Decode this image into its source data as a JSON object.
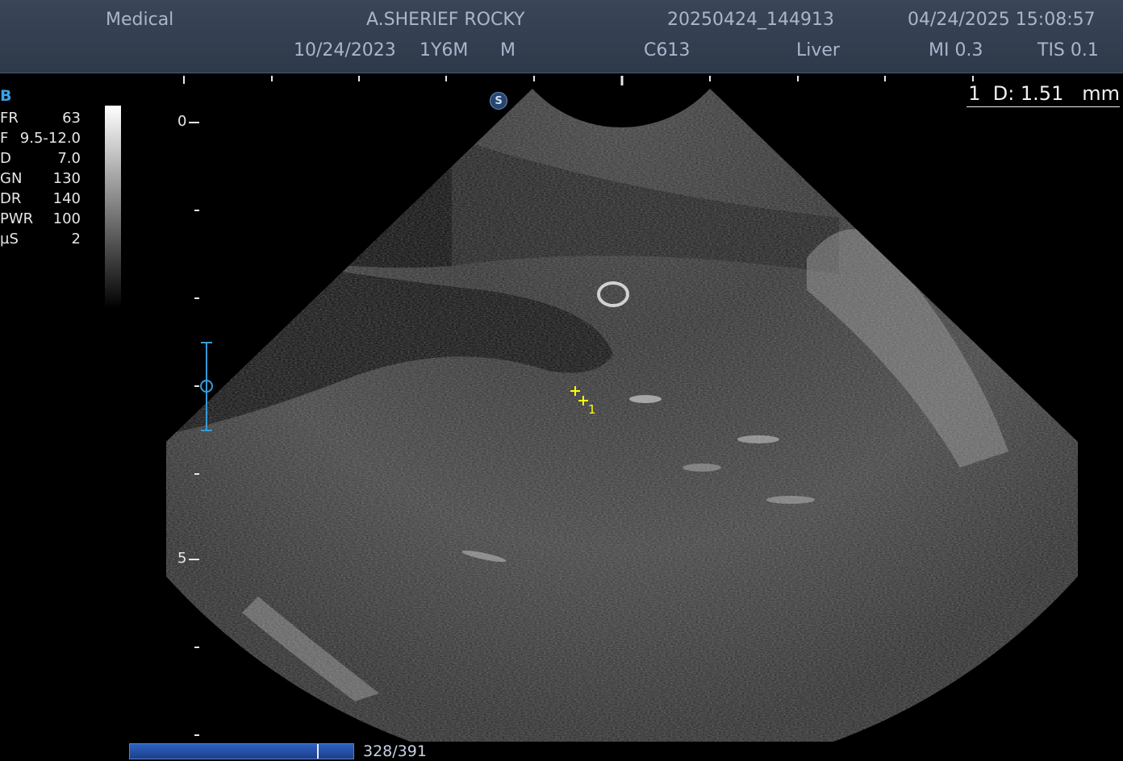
{
  "header": {
    "mode": "Medical",
    "patient_name": "A.SHERIEF ROCKY",
    "exam_id": "20250424_144913",
    "datetime": "04/24/2025 15:08:57",
    "birth_date": "10/24/2023",
    "age": "1Y6M",
    "sex": "M",
    "probe": "C613",
    "preset": "Liver",
    "mi": "MI 0.3",
    "tis": "TIS 0.1"
  },
  "imaging": {
    "mode_label": "B",
    "params": [
      {
        "key": "FR",
        "value": "63"
      },
      {
        "key": "F",
        "value": "9.5-12.0"
      },
      {
        "key": "D",
        "value": "7.0"
      },
      {
        "key": "GN",
        "value": "130"
      },
      {
        "key": "DR",
        "value": "140"
      },
      {
        "key": "PWR",
        "value": "100"
      },
      {
        "key": "µS",
        "value": "2"
      }
    ]
  },
  "depth_scale": {
    "label_0": "0",
    "label_5": "5"
  },
  "measurement": {
    "readout": "1  D: 1.51   mm",
    "caliper_label": "1"
  },
  "sono_badge": "S",
  "cine": {
    "counter": "328/391",
    "position_fraction": 0.839
  },
  "colors": {
    "header_bg": "#323e50",
    "header_text": "#a9b6cb",
    "accent": "#3aa0e8",
    "caliper": "#ffff00",
    "progress": "#2a56aa"
  },
  "icons": [
    "focus-marker-icon",
    "caliper-cross-icon",
    "sono-assist-icon"
  ]
}
